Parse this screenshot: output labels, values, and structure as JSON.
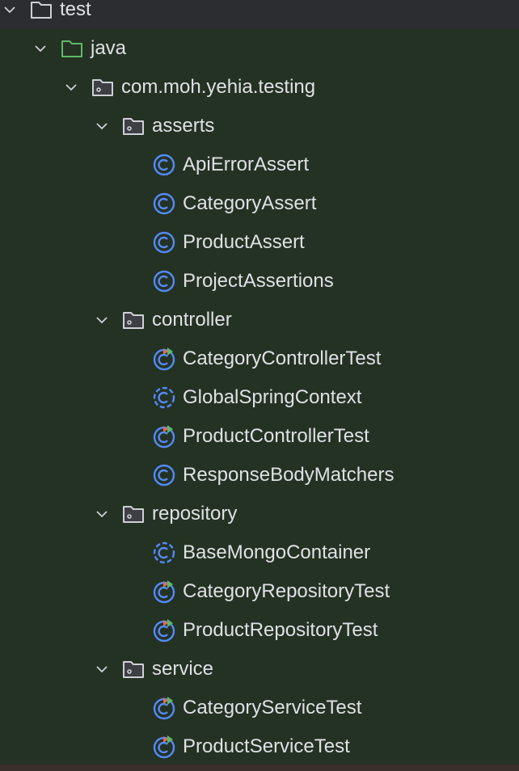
{
  "colors": {
    "background": "#243224",
    "top_row": "#2b2d30",
    "text": "#dfe1e5",
    "class_icon": "#548af7",
    "run_red": "#e06c5a",
    "run_green": "#5fb865"
  },
  "tree": [
    {
      "label": "test",
      "level": 0,
      "type": "folder",
      "expanded": true
    },
    {
      "label": "java",
      "level": 1,
      "type": "source-folder",
      "expanded": true
    },
    {
      "label": "com.moh.yehia.testing",
      "level": 2,
      "type": "package",
      "expanded": true
    },
    {
      "label": "asserts",
      "level": 3,
      "type": "package",
      "expanded": true
    },
    {
      "label": "ApiErrorAssert",
      "level": 4,
      "type": "class"
    },
    {
      "label": "CategoryAssert",
      "level": 4,
      "type": "class"
    },
    {
      "label": "ProductAssert",
      "level": 4,
      "type": "class"
    },
    {
      "label": "ProjectAssertions",
      "level": 4,
      "type": "class"
    },
    {
      "label": "controller",
      "level": 3,
      "type": "package",
      "expanded": true
    },
    {
      "label": "CategoryControllerTest",
      "level": 4,
      "type": "test-class"
    },
    {
      "label": "GlobalSpringContext",
      "level": 4,
      "type": "abstract-class"
    },
    {
      "label": "ProductControllerTest",
      "level": 4,
      "type": "test-class"
    },
    {
      "label": "ResponseBodyMatchers",
      "level": 4,
      "type": "class"
    },
    {
      "label": "repository",
      "level": 3,
      "type": "package",
      "expanded": true
    },
    {
      "label": "BaseMongoContainer",
      "level": 4,
      "type": "abstract-class"
    },
    {
      "label": "CategoryRepositoryTest",
      "level": 4,
      "type": "test-class"
    },
    {
      "label": "ProductRepositoryTest",
      "level": 4,
      "type": "test-class"
    },
    {
      "label": "service",
      "level": 3,
      "type": "package",
      "expanded": true
    },
    {
      "label": "CategoryServiceTest",
      "level": 4,
      "type": "test-class"
    },
    {
      "label": "ProductServiceTest",
      "level": 4,
      "type": "test-class"
    }
  ]
}
